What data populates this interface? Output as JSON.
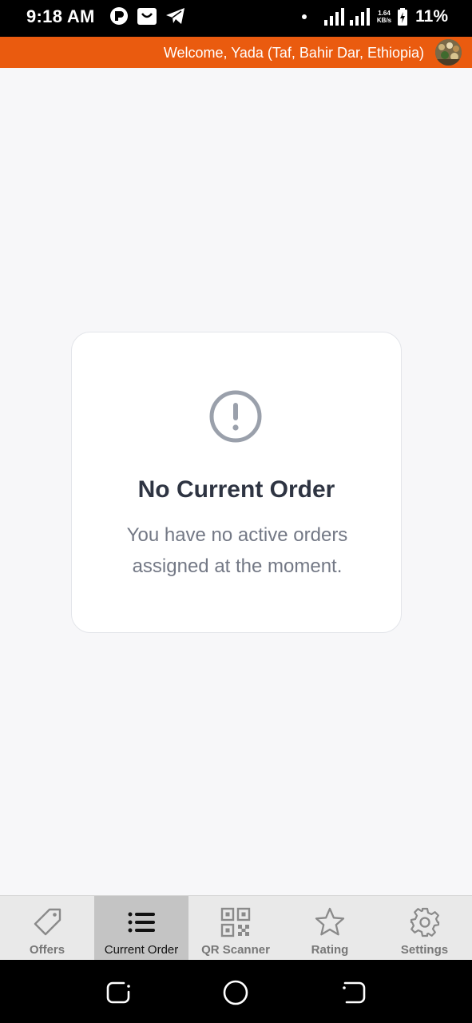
{
  "status_bar": {
    "time": "9:18 AM",
    "network_speed_value": "1.64",
    "network_speed_unit": "KB/s",
    "battery": "11%",
    "icons": [
      "app-icon",
      "shop-icon",
      "telegram-icon",
      "dot-icon",
      "signal-icon",
      "signal-icon",
      "battery-icon"
    ]
  },
  "header": {
    "welcome": "Welcome, Yada (Taf, Bahir Dar, Ethiopia)",
    "accent_color": "#ea5b0f"
  },
  "empty_state": {
    "icon": "alert-circle-icon",
    "title": "No Current Order",
    "message": "You have no active orders assigned at the moment."
  },
  "bottom_nav": {
    "active": "Current Order",
    "items": [
      {
        "label": "Offers",
        "icon": "tag-icon"
      },
      {
        "label": "Current Order",
        "icon": "list-icon"
      },
      {
        "label": "QR Scanner",
        "icon": "qr-code-icon"
      },
      {
        "label": "Rating",
        "icon": "star-icon"
      },
      {
        "label": "Settings",
        "icon": "gear-icon"
      }
    ]
  },
  "system_nav": {
    "icons": [
      "recents-icon",
      "home-icon",
      "back-icon"
    ]
  }
}
